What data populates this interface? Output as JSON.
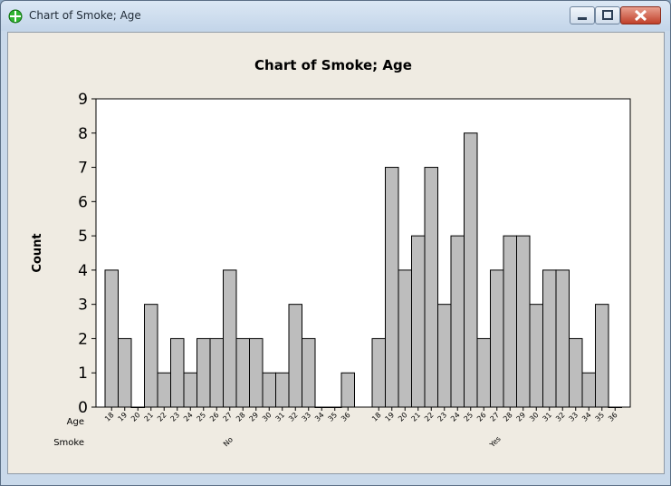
{
  "window": {
    "title": "Chart of Smoke; Age"
  },
  "colors": {
    "bar": "#bdbdbd",
    "stroke": "#000000",
    "background": "#efebe2",
    "plot_bg": "#ffffff"
  },
  "icons": {
    "app": "minitab-crosshair-icon",
    "minimize": "minimize-icon",
    "maximize": "maximize-icon",
    "close": "close-icon"
  },
  "chart_data": {
    "type": "bar",
    "title": "Chart of Smoke; Age",
    "ylabel": "Count",
    "ylim": [
      0,
      9
    ],
    "yticks": [
      "0",
      "1",
      "2",
      "3",
      "4",
      "5",
      "6",
      "7",
      "8",
      "9"
    ],
    "grid": false,
    "row_labels": {
      "inner": "Age",
      "outer": "Smoke"
    },
    "groups": [
      {
        "name": "No",
        "categories": [
          "18",
          "19",
          "20",
          "21",
          "22",
          "23",
          "24",
          "25",
          "26",
          "27",
          "28",
          "29",
          "30",
          "31",
          "32",
          "33",
          "34",
          "35",
          "36"
        ],
        "values": [
          4,
          2,
          0,
          3,
          1,
          2,
          1,
          2,
          2,
          4,
          2,
          2,
          1,
          1,
          3,
          2,
          0,
          0,
          1
        ]
      },
      {
        "name": "Yes",
        "categories": [
          "18",
          "19",
          "20",
          "21",
          "22",
          "23",
          "24",
          "25",
          "26",
          "27",
          "28",
          "29",
          "30",
          "31",
          "32",
          "33",
          "34",
          "35",
          "36"
        ],
        "values": [
          2,
          7,
          4,
          5,
          7,
          3,
          5,
          8,
          2,
          4,
          5,
          5,
          3,
          4,
          4,
          2,
          1,
          3,
          0
        ]
      }
    ]
  }
}
